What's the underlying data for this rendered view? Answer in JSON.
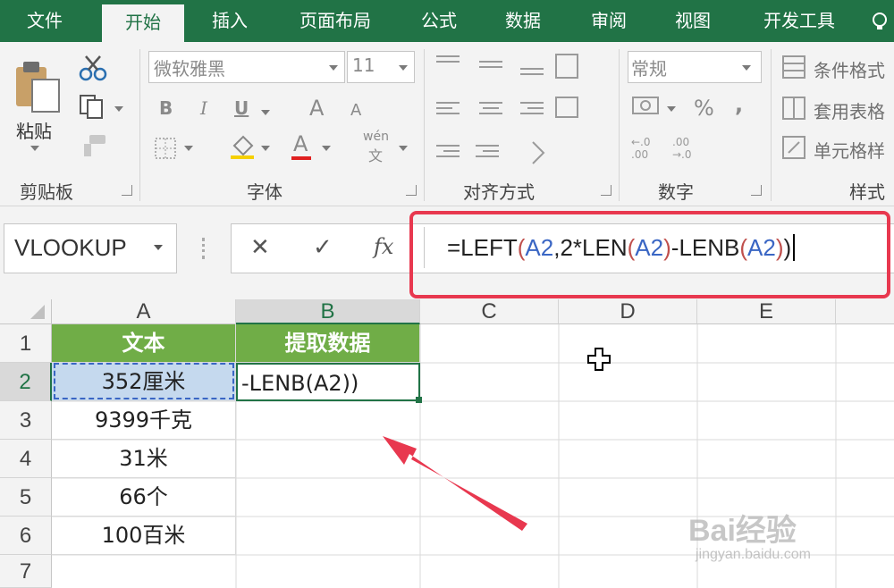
{
  "menu": {
    "tabs": [
      {
        "label": "文件"
      },
      {
        "label": "开始"
      },
      {
        "label": "插入"
      },
      {
        "label": "页面布局"
      },
      {
        "label": "公式"
      },
      {
        "label": "数据"
      },
      {
        "label": "审阅"
      },
      {
        "label": "视图"
      },
      {
        "label": "开发工具"
      }
    ],
    "active_tab": "开始"
  },
  "ribbon": {
    "clipboard": {
      "paste_label": "粘贴",
      "group_label": "剪贴板"
    },
    "font": {
      "font_name": "微软雅黑",
      "font_size": "11",
      "group_label": "字体",
      "bold": "B",
      "italic": "I",
      "underline": "U",
      "grow": "A",
      "shrink": "A",
      "font_color": "A",
      "phonetic_top": "wén",
      "phonetic_bottom": "文"
    },
    "alignment": {
      "group_label": "对齐方式"
    },
    "number": {
      "format": "常规",
      "group_label": "数字",
      "percent": "%",
      "comma": ","
    },
    "styles": {
      "conditional": "条件格式",
      "table": "套用表格",
      "cell": "单元格样",
      "group_label": "样式"
    }
  },
  "formula_bar": {
    "name_box": "VLOOKUP",
    "cancel": "✕",
    "enter": "✓",
    "fx": "fx",
    "formula": {
      "p1": "=LEFT",
      "p2": "(",
      "p3": "A2",
      "p4": ",2*LEN",
      "p5": "(",
      "p6": "A2",
      "p7": ")",
      "p8": "-LENB",
      "p9": "(",
      "p10": "A2",
      "p11": ")",
      "p12": ")"
    }
  },
  "sheet": {
    "columns": [
      "A",
      "B",
      "C",
      "D",
      "E"
    ],
    "rows": [
      "1",
      "2",
      "3",
      "4",
      "5",
      "6",
      "7"
    ],
    "header_row": {
      "a": "文本",
      "b": "提取数据"
    },
    "cells": {
      "a2": "352厘米",
      "b2": "-LENB(A2))",
      "a3": "9399千克",
      "a4": "31米",
      "a5": "66个",
      "a6": "100百米"
    }
  },
  "watermark": {
    "brand": "Bai经验",
    "site": "jingyan.baidu.com"
  },
  "colors": {
    "excel_green": "#217346",
    "header_fill": "#70ad47",
    "highlight": "#e8384f",
    "arrow": "#e8384f"
  }
}
